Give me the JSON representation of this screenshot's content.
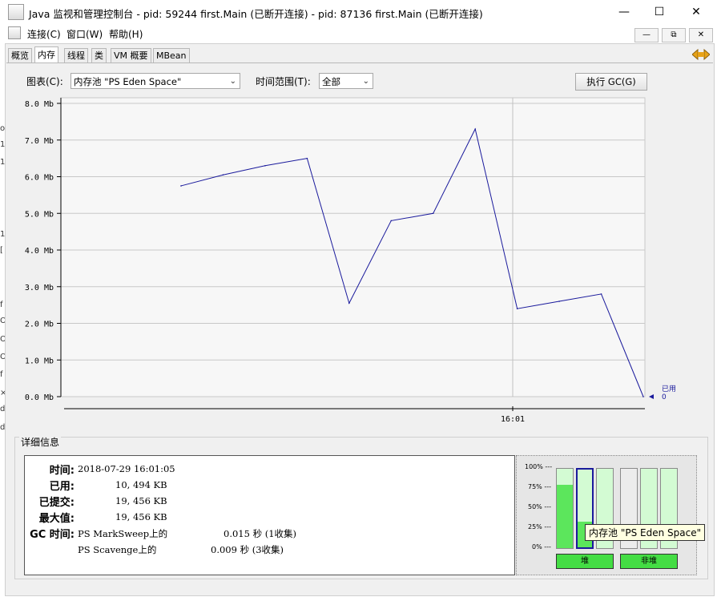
{
  "window": {
    "title": "Java 监视和管理控制台 - pid: 59244 first.Main (已断开连接) - pid: 87136 first.Main (已断开连接)",
    "minimize_glyph": "—",
    "maximize_glyph": "☐",
    "close_glyph": "✕"
  },
  "menu": {
    "items": [
      "连接(C)",
      "窗口(W)",
      "帮助(H)"
    ],
    "mdi_buttons": [
      "—",
      "⧉",
      "✕"
    ]
  },
  "tabs": [
    {
      "label": "概览",
      "active": false
    },
    {
      "label": "内存",
      "active": true
    },
    {
      "label": "线程",
      "active": false
    },
    {
      "label": "类",
      "active": false
    },
    {
      "label": "VM 概要",
      "active": false
    },
    {
      "label": "MBean",
      "active": false
    }
  ],
  "controls": {
    "chart_label": "图表(C):",
    "chart_value": "内存池 \"PS Eden Space\"",
    "time_range_label": "时间范围(T):",
    "time_range_value": "全部",
    "gc_button": "执行 GC(G)"
  },
  "chart_data": {
    "type": "line",
    "y_ticks": [
      "8.0 Mb",
      "7.0 Mb",
      "6.0 Mb",
      "5.0 Mb",
      "4.0 Mb",
      "3.0 Mb",
      "2.0 Mb",
      "1.0 Mb",
      "0.0 Mb"
    ],
    "ylim": [
      0,
      8
    ],
    "x_tick_label": "16:01",
    "series": [
      {
        "name": "已用",
        "color": "#1a1a9c",
        "values": [
          5.75,
          6.05,
          6.3,
          6.5,
          2.55,
          4.8,
          5.0,
          7.3,
          2.4,
          2.6,
          2.8,
          0.0
        ]
      }
    ],
    "legend_label": "已用",
    "legend_value": "0"
  },
  "details": {
    "title": "详细信息",
    "time_label": "时间:",
    "time_value": "2018-07-29 16:01:05",
    "used_label": "已用:",
    "used_value": "10, 494 KB",
    "committed_label": "已提交:",
    "committed_value": "19, 456 KB",
    "max_label": "最大值:",
    "max_value": "19, 456 KB",
    "gc_label": "GC 时间:",
    "gc1_name": "PS MarkSweep上的",
    "gc1_value": "0.015 秒 (1收集)",
    "gc2_name": "PS Scavenge上的",
    "gc2_value": "0.009 秒 (3收集)"
  },
  "pools": {
    "pct_labels": [
      "100% ---",
      "75% ---",
      "50% ---",
      "25% ---",
      "0% ---"
    ],
    "heap_label": "堆",
    "nonheap_label": "非堆",
    "fills": [
      0.8,
      0.33,
      0.0,
      0.0,
      0.0,
      0.0
    ],
    "tooltip": "内存池 \"PS Eden Space\""
  }
}
